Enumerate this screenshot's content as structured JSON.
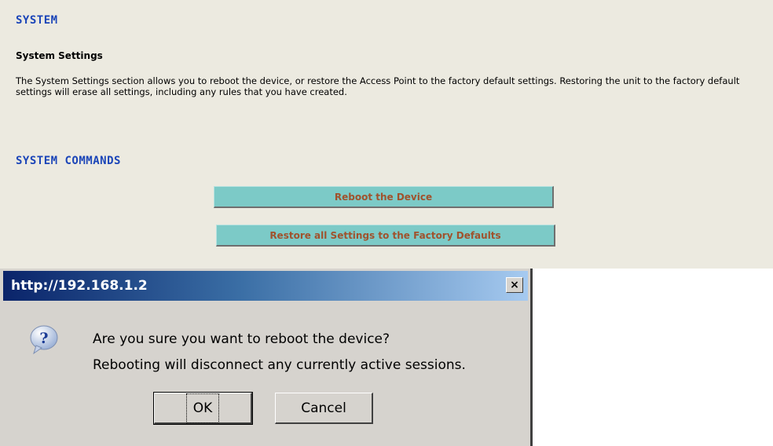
{
  "page": {
    "section_title": "SYSTEM",
    "subsection_title": "System Settings",
    "description": "The System Settings section allows you to reboot the device, or restore the Access Point to the factory default settings. Restoring the unit to the factory default settings will erase all settings, including any rules that you have created.",
    "commands_title": "SYSTEM COMMANDS",
    "reboot_button": "Reboot the Device",
    "restore_button": "Restore all Settings to the Factory Defaults"
  },
  "dialog": {
    "title": "http://192.168.1.2",
    "close_glyph": "×",
    "icon": "question-balloon-icon",
    "line1": "Are you sure you want to reboot the device?",
    "line2": "Rebooting will disconnect any currently active sessions.",
    "ok_label": "OK",
    "cancel_label": "Cancel"
  },
  "colors": {
    "heading": "#1b45b8",
    "button_bg": "#7ccac7",
    "button_text": "#a0522d",
    "page_bg": "#eceae0",
    "dialog_bg": "#d6d3ce",
    "titlebar_start": "#0a246a"
  }
}
